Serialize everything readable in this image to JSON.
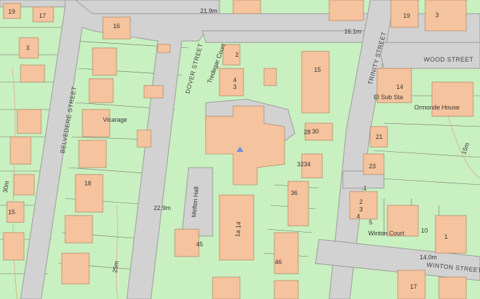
{
  "colors": {
    "land": "#c9f0c0",
    "road": "#d2d2d2",
    "road_edge": "#9a9a9a",
    "building": "#f5c39d",
    "building_edge": "#b38a6a",
    "parcel_line": "#6b6b6b",
    "contour": "#d9a97a",
    "church_marker": "#6a8fd8"
  },
  "streets": {
    "dover": "DOVER STREET",
    "belvedere": "BELVEDERE STREET",
    "trinity": "TRINITY STREET",
    "wood": "WOOD STREET",
    "winton": "WINTON STREET"
  },
  "places": {
    "vicarage": "Vicarage",
    "el_sub_sta": "El Sub Sta",
    "ormonde_house": "Ormonde House",
    "tredegar_court": "Tredegar Court",
    "melton_hall": "Melton Hall",
    "winton_court": "Winton Court"
  },
  "spot_heights": {
    "h1": "21.9m",
    "h2": "16.1m",
    "h3": "22.9m",
    "h4": "14.0m"
  },
  "contours": {
    "c1": "30m",
    "c2": "25m",
    "c3": "15m"
  },
  "house_numbers": {
    "n19a": "19",
    "n17": "17",
    "n16": "16",
    "n3a": "3",
    "n2": "2",
    "n4": "4",
    "n3b": "3",
    "n15a": "15",
    "n19b": "19",
    "n3c": "3",
    "n14": "14",
    "n28": "28",
    "n30": "30",
    "n32": "32",
    "n34": "34",
    "n21": "21",
    "n23": "23",
    "n18": "18",
    "n36": "36",
    "n15b": "15",
    "n1to14": "1a 14",
    "n45": "45",
    "n46": "46",
    "n1a": "1",
    "n2b": "2",
    "n3d": "3",
    "n4b": "4",
    "n5": "5",
    "n10": "10",
    "n1b": "1",
    "n17b": "17"
  }
}
